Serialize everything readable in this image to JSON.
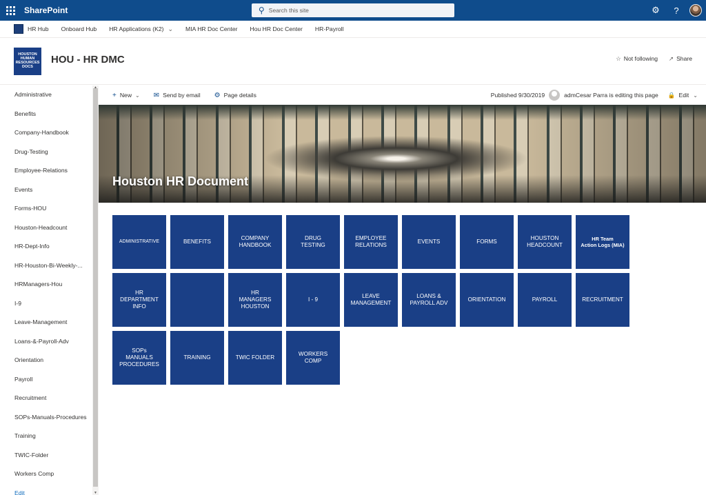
{
  "suitebar": {
    "app_name": "SharePoint",
    "search_placeholder": "Search this site",
    "icons": [
      "waffle-icon",
      "search-icon",
      "gear-icon",
      "help-icon",
      "avatar"
    ]
  },
  "hubnav": {
    "items": [
      {
        "label": "HR Hub"
      },
      {
        "label": "Onboard Hub"
      },
      {
        "label": "HR Applications (K2)",
        "has_dropdown": true
      },
      {
        "label": "MIA HR Doc Center"
      },
      {
        "label": "Hou HR Doc Center"
      },
      {
        "label": "HR-Payroll"
      }
    ]
  },
  "site": {
    "logo_text": [
      "HOUSTON",
      "HUMAN",
      "RESOURCES",
      "DOCS"
    ],
    "title": "HOU - HR DMC",
    "follow_label": "Not following",
    "share_label": "Share"
  },
  "leftnav": {
    "items": [
      "Administrative",
      "Benefits",
      "Company-Handbook",
      "Drug-Testing",
      "Employee-Relations",
      "Events",
      "Forms-HOU",
      "Houston-Headcount",
      "HR-Dept-Info",
      "HR-Houston-Bi-Weekly-...",
      "HRManagers-Hou",
      "I-9",
      "Leave-Management",
      "Loans-&-Payroll-Adv",
      "Orientation",
      "Payroll",
      "Recruitment",
      "SOPs-Manuals-Procedures",
      "Training",
      "TWIC-Folder",
      "Workers Comp"
    ],
    "edit_label": "Edit"
  },
  "commandbar": {
    "new_label": "New",
    "send_label": "Send by email",
    "details_label": "Page details",
    "published": "Published 9/30/2019",
    "editing": "admCesar Parra is editing this page",
    "edit_label": "Edit"
  },
  "hero": {
    "title": "Houston HR Document"
  },
  "tiles": [
    {
      "label": "ADMINISTRATIVE",
      "style": "small"
    },
    {
      "label": "BENEFITS"
    },
    {
      "label": "COMPANY\nHANDBOOK"
    },
    {
      "label": "DRUG\nTESTING"
    },
    {
      "label": "EMPLOYEE\nRELATIONS"
    },
    {
      "label": "EVENTS"
    },
    {
      "label": "FORMS"
    },
    {
      "label": "HOUSTON\nHEADCOUNT"
    },
    {
      "label": "HR Team\nAction Logs (MIA)",
      "style": "bold"
    },
    {
      "label": "HR\nDEPARTMENT\nINFO"
    },
    {
      "label": ""
    },
    {
      "label": "HR\nMANAGERS\nHOUSTON"
    },
    {
      "label": "I - 9"
    },
    {
      "label": "LEAVE\nMANAGEMENT"
    },
    {
      "label": "LOANS &\nPAYROLL ADV"
    },
    {
      "label": "ORIENTATION"
    },
    {
      "label": "PAYROLL"
    },
    {
      "label": "RECRUITMENT"
    },
    {
      "label": "SOPs\nMANUALS\nPROCEDURES"
    },
    {
      "label": "TRAINING"
    },
    {
      "label": "TWIC FOLDER"
    },
    {
      "label": "WORKERS\nCOMP"
    }
  ],
  "colors": {
    "suitebar": "#0f4c8c",
    "tile": "#1a3f86",
    "link": "#0f6cbd"
  }
}
